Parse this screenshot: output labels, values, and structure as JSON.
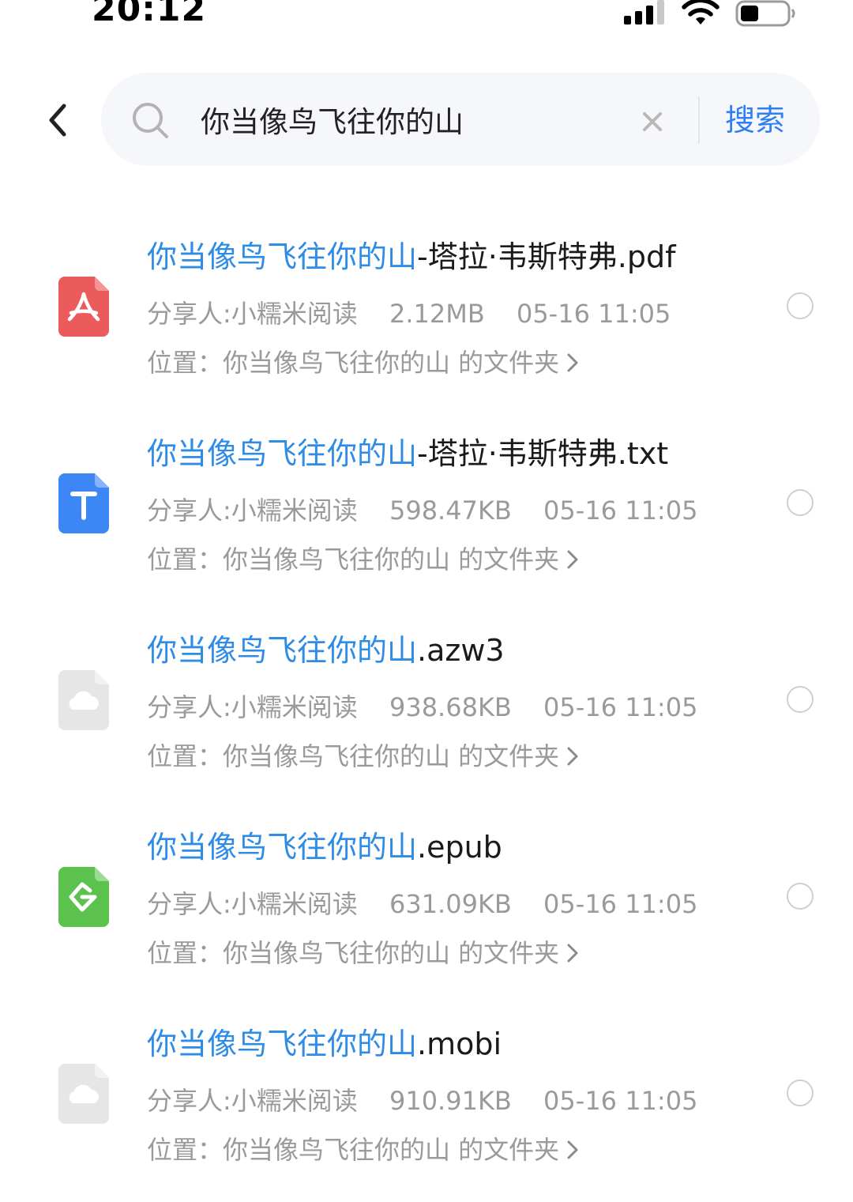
{
  "status_bar": {
    "time": "20:12"
  },
  "search": {
    "query": "你当像鸟飞往你的山",
    "button_label": "搜索"
  },
  "results": [
    {
      "icon": "pdf-file-icon",
      "name_highlight": "你当像鸟飞往你的山",
      "name_rest": "-塔拉·韦斯特弗.pdf",
      "sharer": "分享人:小糯米阅读",
      "size": "2.12MB",
      "date": "05-16 11:05",
      "location": "位置：你当像鸟飞往你的山 的文件夹"
    },
    {
      "icon": "txt-file-icon",
      "name_highlight": "你当像鸟飞往你的山",
      "name_rest": "-塔拉·韦斯特弗.txt",
      "sharer": "分享人:小糯米阅读",
      "size": "598.47KB",
      "date": "05-16 11:05",
      "location": "位置：你当像鸟飞往你的山 的文件夹"
    },
    {
      "icon": "cloud-file-icon",
      "name_highlight": "你当像鸟飞往你的山",
      "name_rest": ".azw3",
      "sharer": "分享人:小糯米阅读",
      "size": "938.68KB",
      "date": "05-16 11:05",
      "location": "位置：你当像鸟飞往你的山 的文件夹"
    },
    {
      "icon": "epub-file-icon",
      "name_highlight": "你当像鸟飞往你的山",
      "name_rest": ".epub",
      "sharer": "分享人:小糯米阅读",
      "size": "631.09KB",
      "date": "05-16 11:05",
      "location": "位置：你当像鸟飞往你的山 的文件夹"
    },
    {
      "icon": "cloud-file-icon",
      "name_highlight": "你当像鸟飞往你的山",
      "name_rest": ".mobi",
      "sharer": "分享人:小糯米阅读",
      "size": "910.91KB",
      "date": "05-16 11:05",
      "location": "位置：你当像鸟飞往你的山 的文件夹"
    }
  ],
  "colors": {
    "accent": "#2e7ef4",
    "highlight": "#2e8ce6",
    "pdf": "#ec5b5b",
    "txt": "#3d86f5",
    "epub": "#5cc24e",
    "cloud": "#e6e6e6",
    "muted_text": "#9a9a9a"
  }
}
